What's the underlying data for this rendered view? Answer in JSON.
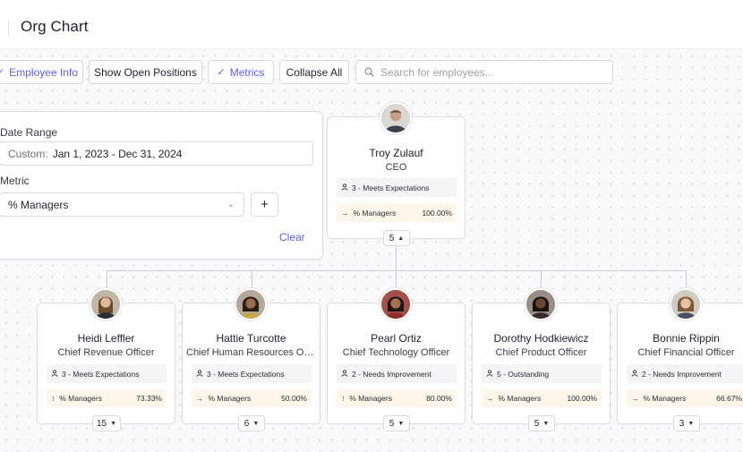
{
  "header": {
    "title": "Org Chart"
  },
  "toolbar": {
    "employee_info": "Employee Info",
    "open_positions": "Show Open Positions",
    "metrics": "Metrics",
    "collapse_all": "Collapse All",
    "search_placeholder": "Search for employees..."
  },
  "filter_panel": {
    "date_range_label": "Date Range",
    "date_prefix": "Custom:",
    "date_value": "Jan 1, 2023 - Dec 31, 2024",
    "metric_label": "Metric",
    "metric_value": "% Managers",
    "add_label": "+",
    "clear_label": "Clear"
  },
  "root": {
    "name": "Troy Zulauf",
    "role": "CEO",
    "rating": "3 - Meets Expectations",
    "metric_name": "% Managers",
    "metric_value": "100.00%",
    "reports": "5"
  },
  "children": [
    {
      "name": "Heidi Leffler",
      "role": "Chief Revenue Officer",
      "rating": "3 - Meets Expectations",
      "trend": "up",
      "metric_name": "% Managers",
      "metric_value": "73.33%",
      "reports": "15"
    },
    {
      "name": "Hattie Turcotte",
      "role": "Chief Human Resources Offi...",
      "rating": "3 - Meets Expectations",
      "trend": "right",
      "metric_name": "% Managers",
      "metric_value": "50.00%",
      "reports": "6"
    },
    {
      "name": "Pearl Ortiz",
      "role": "Chief Technology Officer",
      "rating": "2 - Needs Improvement",
      "trend": "up",
      "metric_name": "% Managers",
      "metric_value": "80.00%",
      "reports": "5"
    },
    {
      "name": "Dorothy Hodkiewicz",
      "role": "Chief Product Officer",
      "rating": "5 - Outstanding",
      "trend": "right",
      "metric_name": "% Managers",
      "metric_value": "100.00%",
      "reports": "5"
    },
    {
      "name": "Bonnie Rippin",
      "role": "Chief Financial Officer",
      "rating": "2 - Needs Improvement",
      "trend": "right",
      "metric_name": "% Managers",
      "metric_value": "66.67%",
      "reports": "3"
    }
  ],
  "colors": {
    "accent": "#5b5fe0",
    "metric_bg": "#fdf6ea",
    "rating_bg": "#f4f4f7"
  },
  "icons": {
    "check": "check-icon",
    "search": "search-icon",
    "person": "person-icon",
    "arrow_right": "arrow-right-icon",
    "arrow_up": "arrow-up-icon",
    "chevron_up": "chevron-up-icon",
    "chevron_down": "chevron-down-icon"
  }
}
